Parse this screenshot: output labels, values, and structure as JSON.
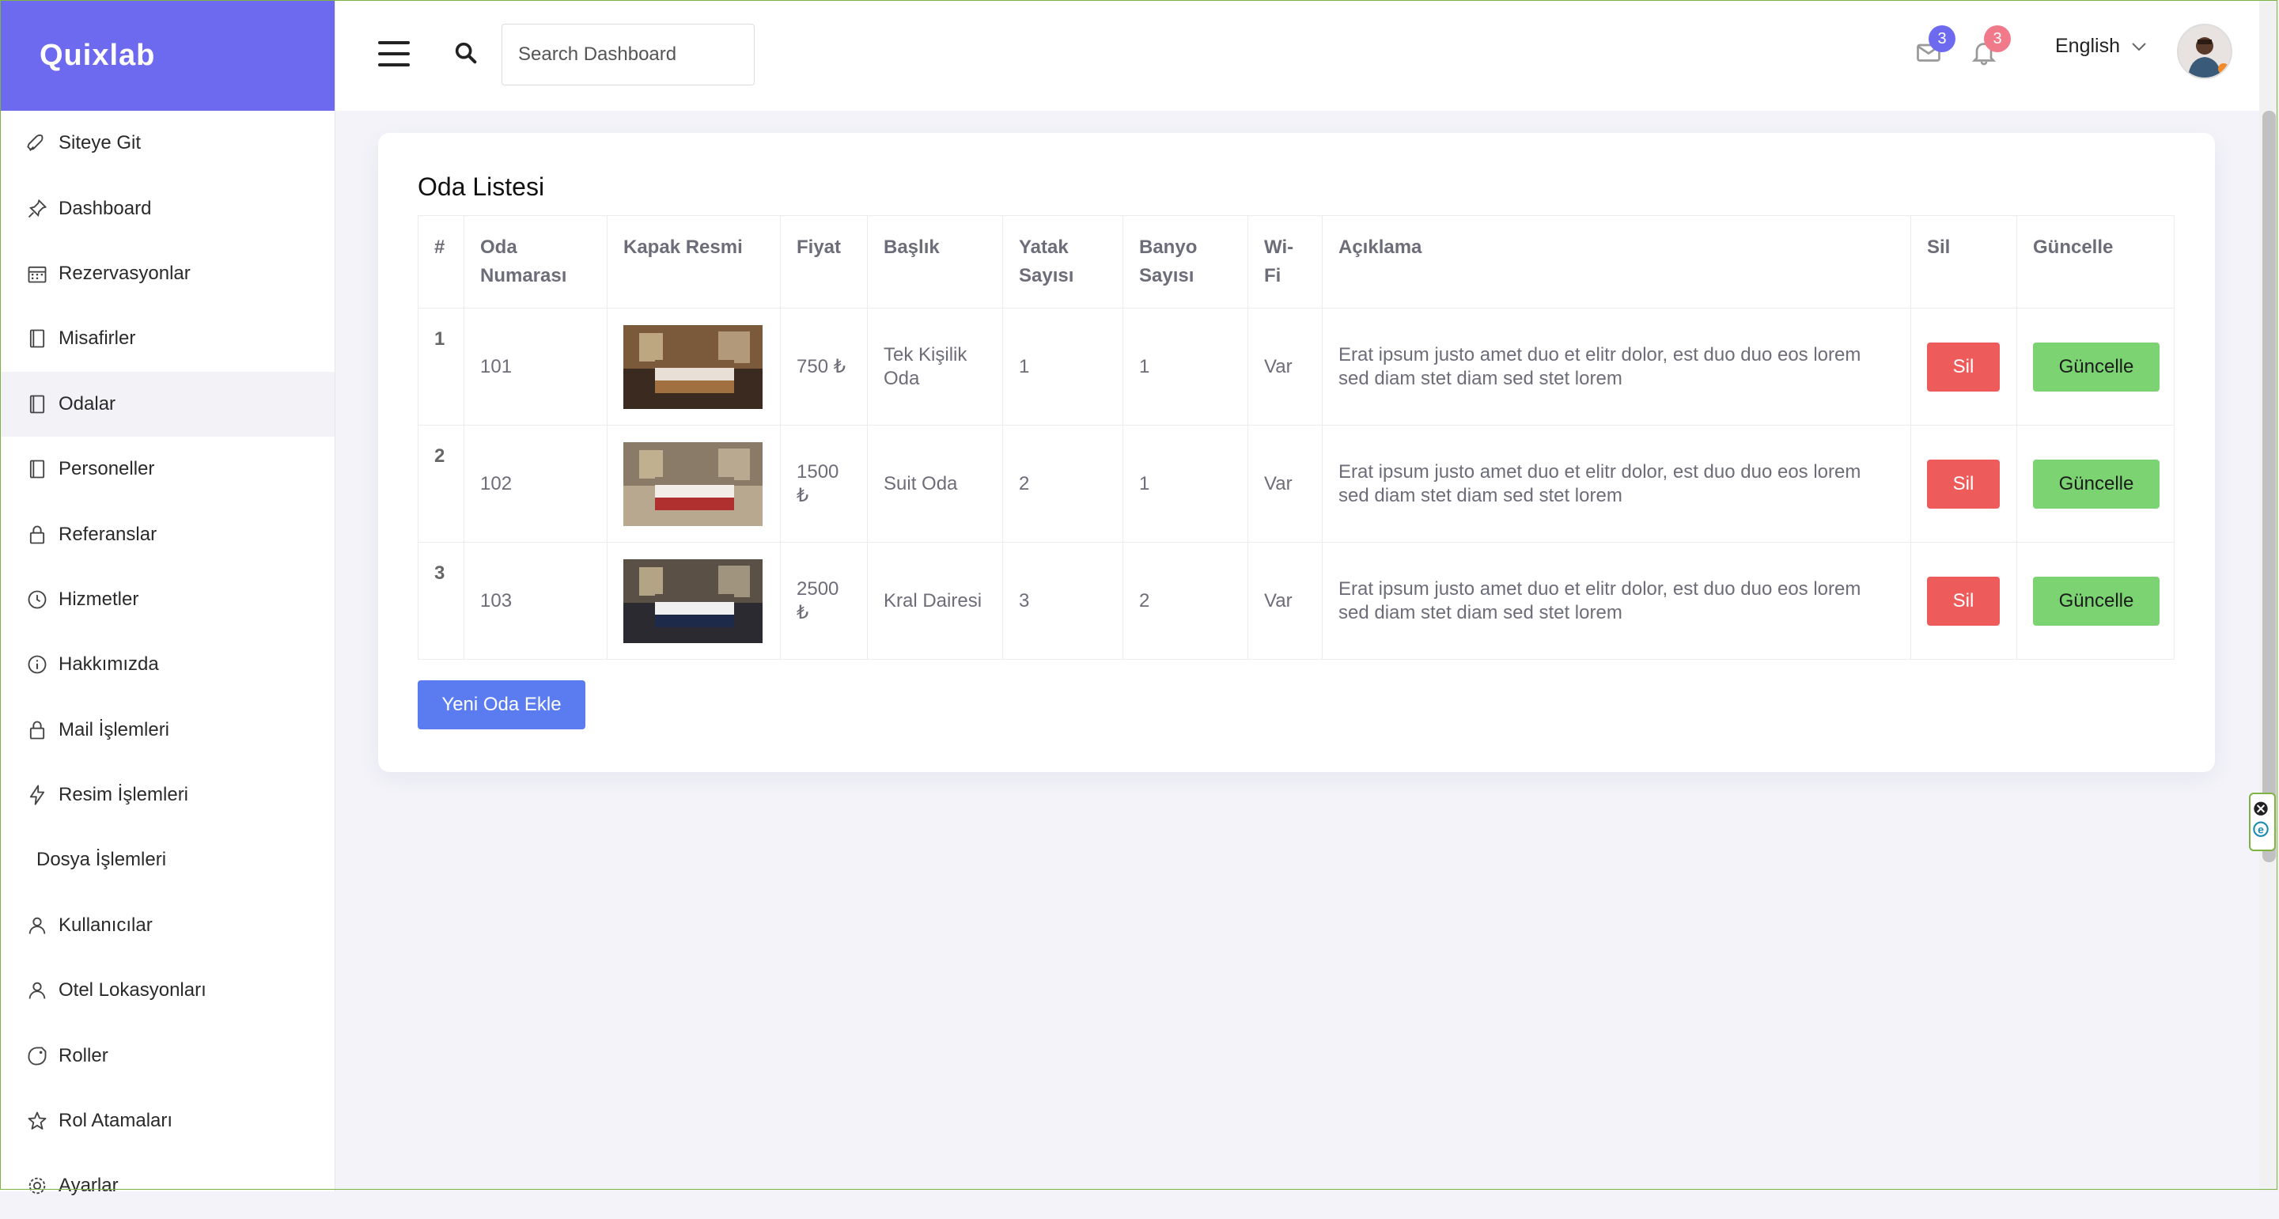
{
  "brand": "Quixlab",
  "sidebar": {
    "items": [
      {
        "label": "Siteye Git",
        "icon": "rocket-icon"
      },
      {
        "label": "Dashboard",
        "icon": "pin-icon"
      },
      {
        "label": "Rezervasyonlar",
        "icon": "calendar-icon"
      },
      {
        "label": "Misafirler",
        "icon": "book-icon"
      },
      {
        "label": "Odalar",
        "icon": "book-icon"
      },
      {
        "label": "Personeller",
        "icon": "book-icon"
      },
      {
        "label": "Referanslar",
        "icon": "lock-icon"
      },
      {
        "label": "Hizmetler",
        "icon": "clock-icon"
      },
      {
        "label": "Hakkımızda",
        "icon": "info-icon"
      },
      {
        "label": "Mail İşlemleri",
        "icon": "lock-icon"
      },
      {
        "label": "Resim İşlemleri",
        "icon": "bolt-icon"
      },
      {
        "label": "Dosya İşlemleri",
        "icon": ""
      },
      {
        "label": "Kullanıcılar",
        "icon": "user-icon"
      },
      {
        "label": "Otel Lokasyonları",
        "icon": "user-icon"
      },
      {
        "label": "Roller",
        "icon": "tag-icon"
      },
      {
        "label": "Rol Atamaları",
        "icon": "star-icon"
      },
      {
        "label": "Ayarlar",
        "icon": "gear-icon"
      }
    ],
    "active_index": 4
  },
  "header": {
    "search_placeholder": "Search Dashboard",
    "mail_count": "3",
    "notif_count": "3",
    "language": "English",
    "mail_badge_color": "#6e6af0",
    "notif_badge_color": "#f07a8a"
  },
  "main": {
    "title": "Oda Listesi",
    "columns": [
      "#",
      "Oda Numarası",
      "Kapak Resmi",
      "Fiyat",
      "Başlık",
      "Yatak Sayısı",
      "Banyo Sayısı",
      "Wi-Fi",
      "Açıklama",
      "Sil",
      "Güncelle"
    ],
    "rows": [
      {
        "num": "1",
        "room": "101",
        "price": "750 ₺",
        "title": "Tek Kişilik Oda",
        "beds": "1",
        "baths": "1",
        "wifi": "Var",
        "desc": "Erat ipsum justo amet duo et elitr dolor, est duo duo eos lorem sed diam stet diam sed stet lorem",
        "del": "Sil",
        "upd": "Güncelle"
      },
      {
        "num": "2",
        "room": "102",
        "price": "1500 ₺",
        "title": "Suit Oda",
        "beds": "2",
        "baths": "1",
        "wifi": "Var",
        "desc": "Erat ipsum justo amet duo et elitr dolor, est duo duo eos lorem sed diam stet diam sed stet lorem",
        "del": "Sil",
        "upd": "Güncelle"
      },
      {
        "num": "3",
        "room": "103",
        "price": "2500 ₺",
        "title": "Kral Dairesi",
        "beds": "3",
        "baths": "2",
        "wifi": "Var",
        "desc": "Erat ipsum justo amet duo et elitr dolor, est duo duo eos lorem sed diam stet diam sed stet lorem",
        "del": "Sil",
        "upd": "Güncelle"
      }
    ],
    "add_button": "Yeni Oda Ekle"
  },
  "colors": {
    "accent": "#6e6af0",
    "danger": "#ee5b5b",
    "success": "#7bd471",
    "primary": "#5b7cf0"
  }
}
